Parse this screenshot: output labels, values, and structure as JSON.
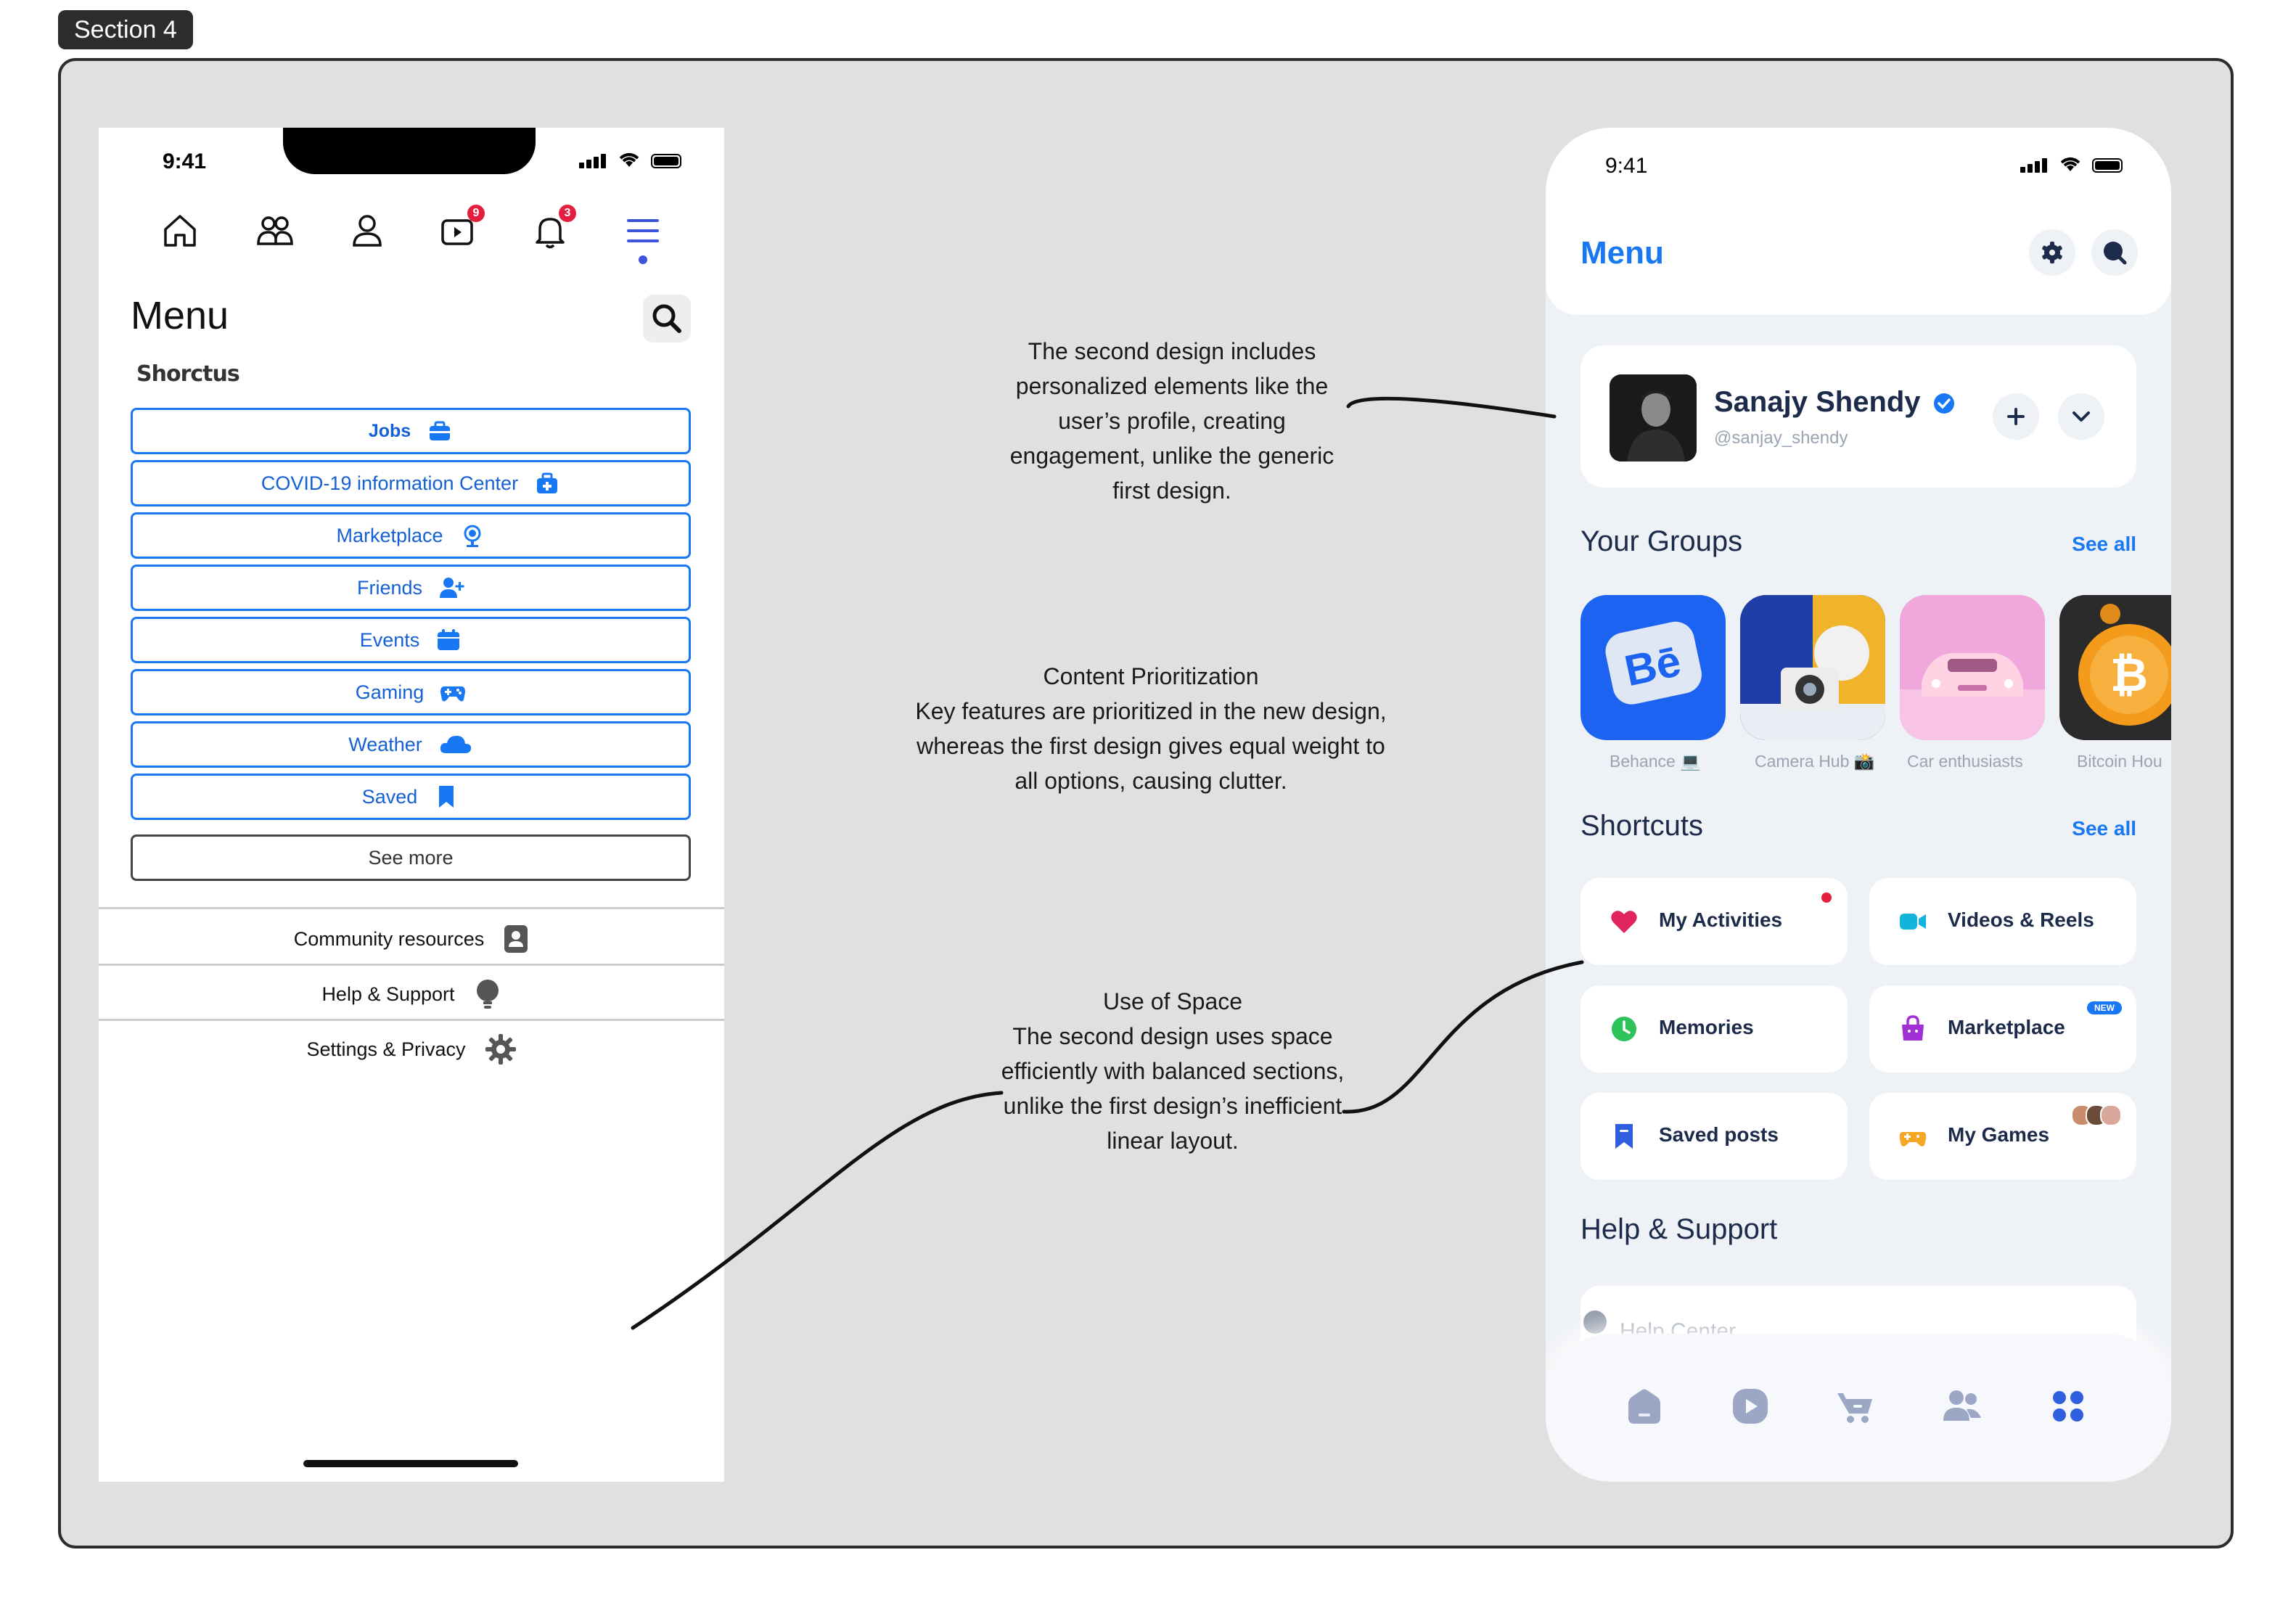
{
  "section_label": "Section 4",
  "old_design": {
    "status_time": "9:41",
    "nav_badges": {
      "watch": "9",
      "notifications": "3"
    },
    "title": "Menu",
    "shortcuts_label": "Shorctus",
    "shortcuts": [
      {
        "label": "Jobs",
        "icon": "briefcase-icon"
      },
      {
        "label": "COVID-19 information Center",
        "icon": "medical-kit-icon"
      },
      {
        "label": "Marketplace",
        "icon": "globe-icon"
      },
      {
        "label": "Friends",
        "icon": "add-friend-icon"
      },
      {
        "label": "Events",
        "icon": "calendar-icon"
      },
      {
        "label": "Gaming",
        "icon": "gamepad-icon"
      },
      {
        "label": "Weather",
        "icon": "cloud-icon"
      },
      {
        "label": "Saved",
        "icon": "bookmark-icon"
      }
    ],
    "see_more": "See more",
    "sections": [
      {
        "label": "Community resources",
        "icon": "contact-book-icon"
      },
      {
        "label": "Help & Support",
        "icon": "lightbulb-icon"
      },
      {
        "label": "Settings & Privacy",
        "icon": "gear-icon"
      }
    ],
    "accent_color": "#1877f2"
  },
  "annotations": {
    "personalization": "The second design includes personalized elements like the user’s profile, creating engagement, unlike the generic first design.",
    "prioritization_title": "Content Prioritization",
    "prioritization_body": "Key features are prioritized in the new design, whereas the first design gives equal weight to all options, causing clutter.",
    "space_title": "Use of Space",
    "space_body": "The second design uses space efficiently with balanced sections, unlike the first design’s inefficient linear layout."
  },
  "new_design": {
    "status_time": "9:41",
    "title": "Menu",
    "profile": {
      "name": "Sanajy Shendy",
      "handle": "@sanjay_shendy",
      "verified": true
    },
    "groups_heading": "Your Groups",
    "groups_see_all": "See all",
    "groups": [
      {
        "label": "Behance 💻"
      },
      {
        "label": "Camera Hub 📸"
      },
      {
        "label": "Car enthusiasts"
      },
      {
        "label": "Bitcoin Hou"
      }
    ],
    "shortcuts_heading": "Shortcuts",
    "shortcuts_see_all": "See all",
    "shortcuts": [
      {
        "label": "My Activities",
        "icon": "heart-icon"
      },
      {
        "label": "Videos & Reels",
        "icon": "video-camera-icon"
      },
      {
        "label": "Memories",
        "icon": "clock-icon"
      },
      {
        "label": "Marketplace",
        "icon": "shopping-bag-icon",
        "badge": "NEW"
      },
      {
        "label": "Saved posts",
        "icon": "bookmark-icon"
      },
      {
        "label": "My Games",
        "icon": "game-controller-icon"
      }
    ],
    "help_heading": "Help & Support",
    "help_center": "Help Center",
    "accent_color": "#1877f2"
  }
}
